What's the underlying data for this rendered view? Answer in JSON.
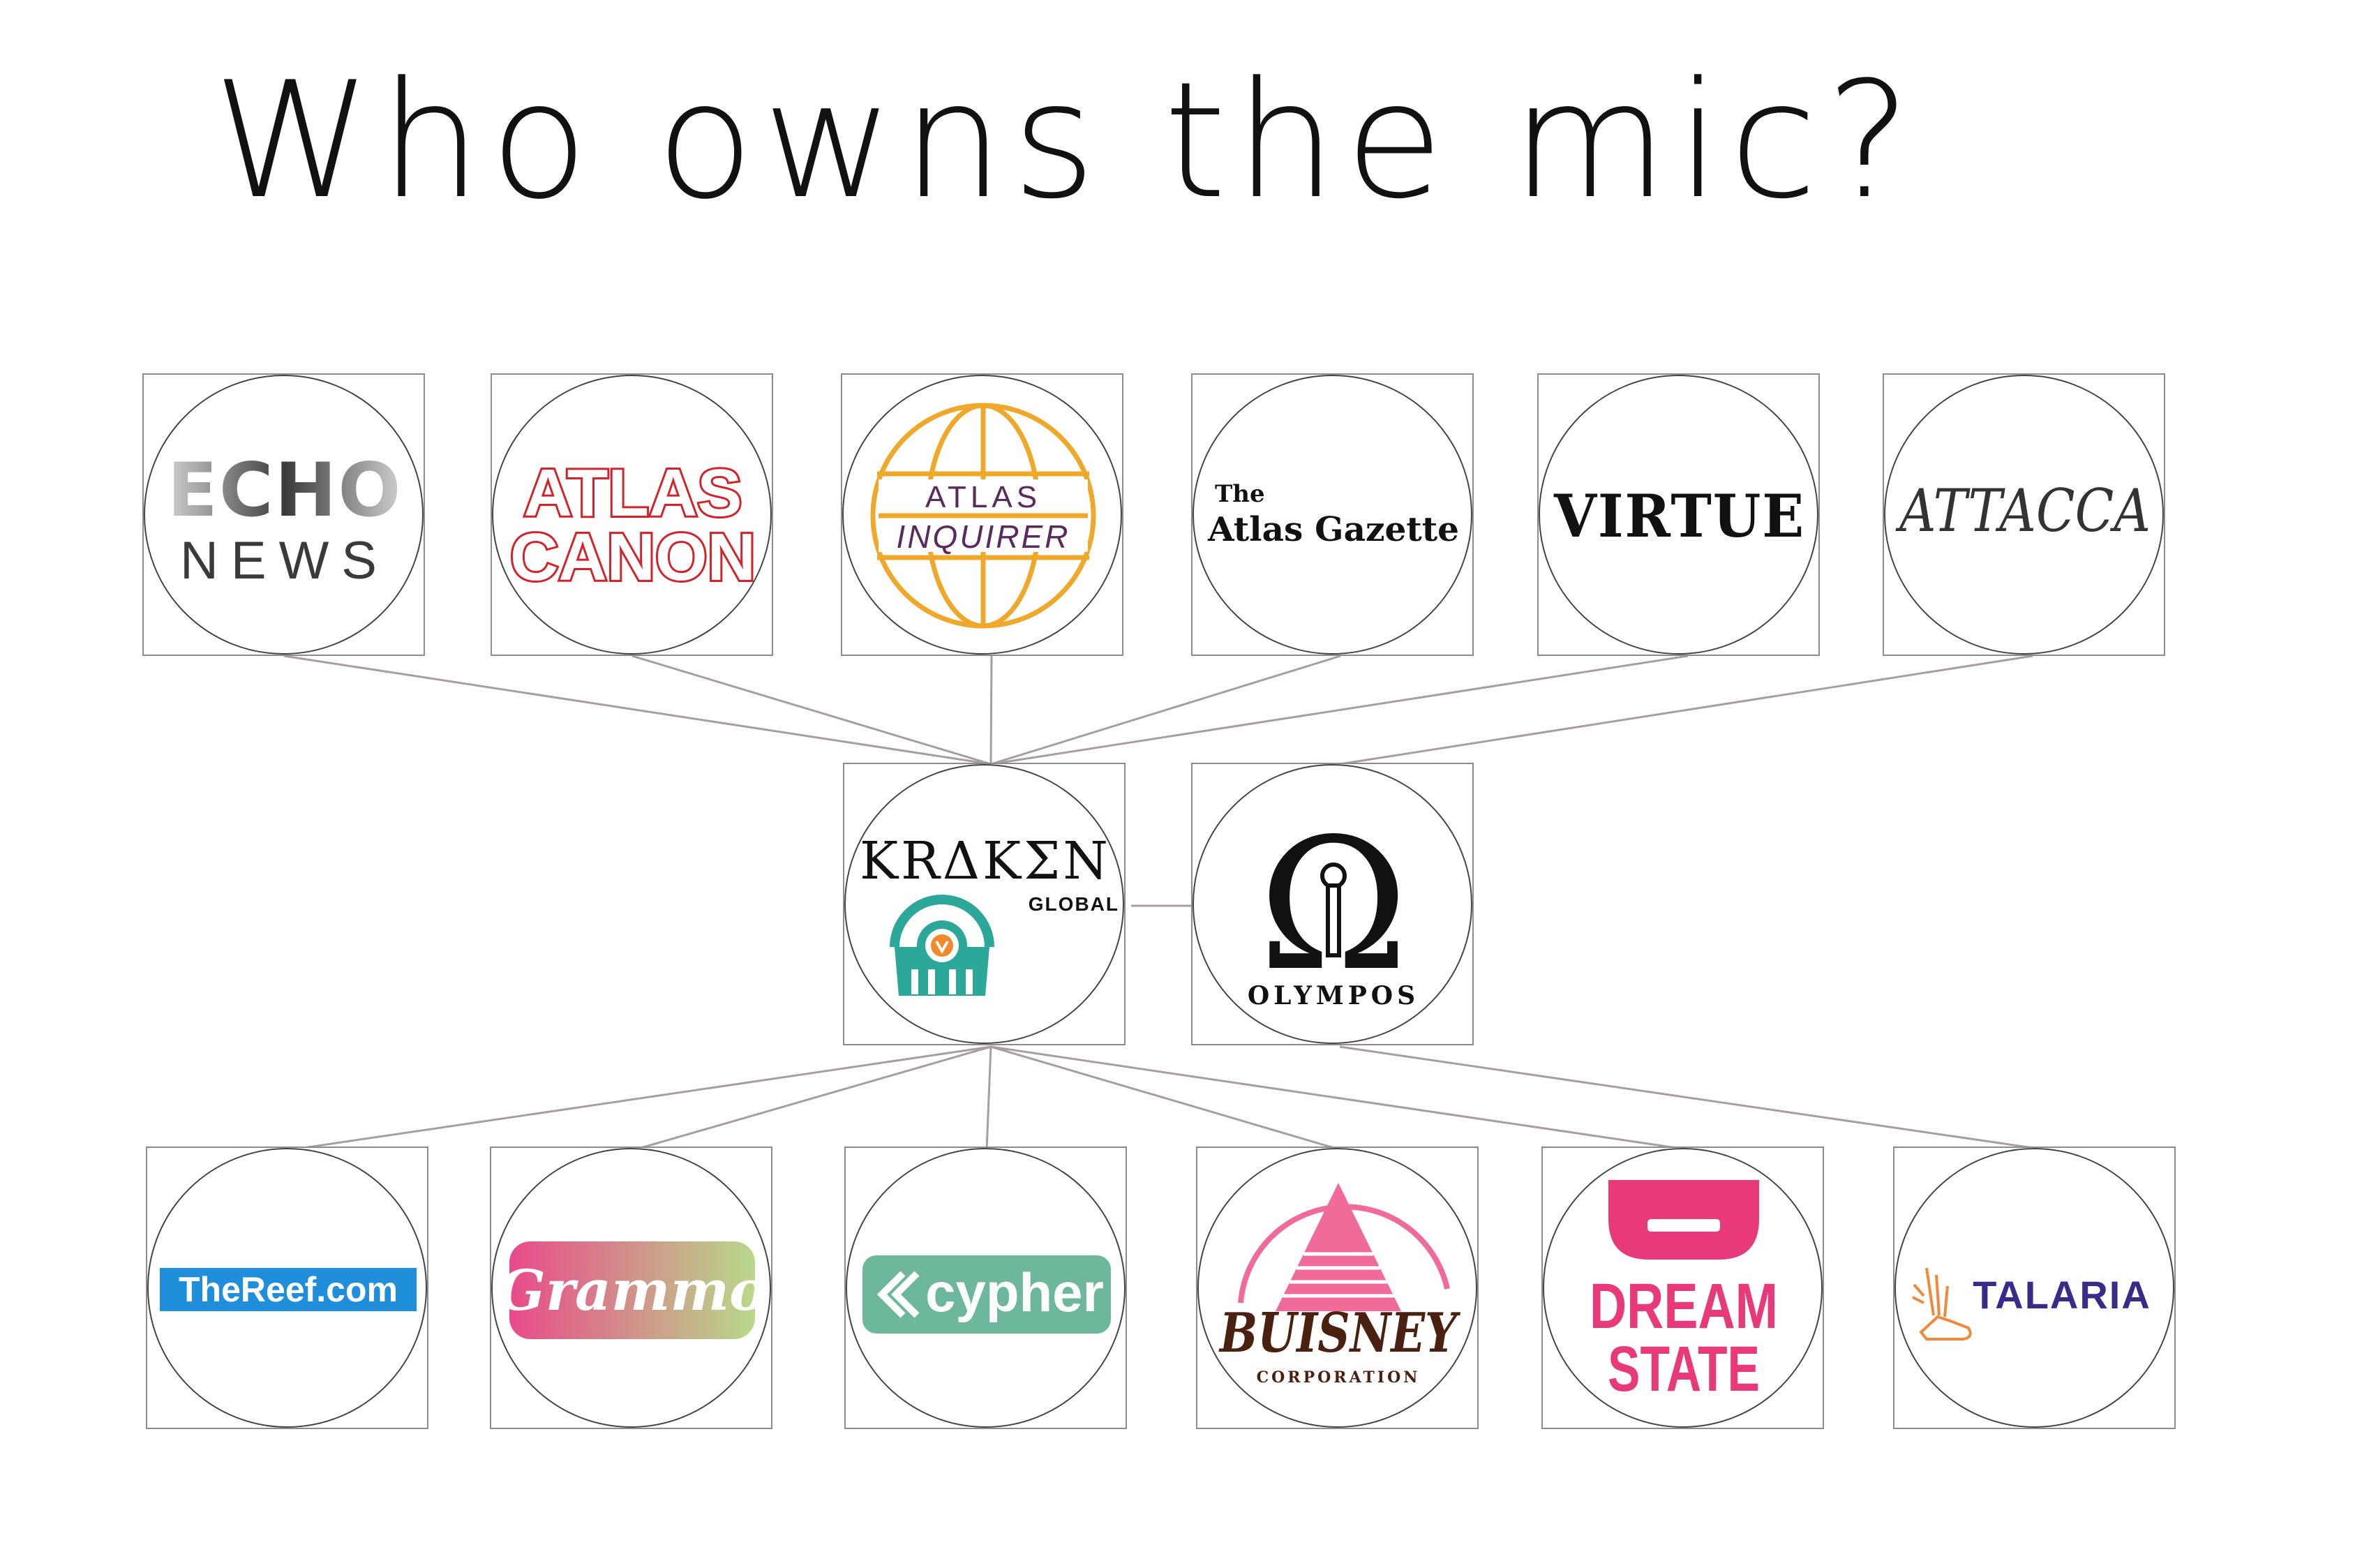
{
  "title": "Who owns the mic?",
  "nodes": {
    "echo": {
      "line1": "ECHO",
      "line2": "NEWS"
    },
    "canon": {
      "line1": "ATLAS",
      "line2": "CANON"
    },
    "inquirer": {
      "line1": "ATLAS",
      "line2": "INQUIRER"
    },
    "gazette": {
      "line1": "The",
      "line2": "Atlas Gazette"
    },
    "virtue": {
      "line1": "VIRTUE"
    },
    "attacca": {
      "line1": "ATTACCA"
    },
    "kraken": {
      "line1": "KRΔKΣN",
      "line2": "GLOBAL"
    },
    "olympos": {
      "glyph": "Ω",
      "line1": "OLYMPOS"
    },
    "reef": {
      "line1": "TheReef.com"
    },
    "grammo": {
      "line1": "Grammo"
    },
    "cypher": {
      "line1": "cypher"
    },
    "buisney": {
      "line1": "BUISNEY",
      "line2": "CORPORATION"
    },
    "dream": {
      "line1": "DREAM",
      "line2": "STATE"
    },
    "talaria": {
      "line1": "TALARIA"
    }
  },
  "colors": {
    "connector": "#a89ea2",
    "canon_red": "#d3222a",
    "inquirer_gold": "#f0a82a",
    "inquirer_purple": "#5a2a5e",
    "kraken_teal": "#2ba89a",
    "kraken_orange": "#f08a2a",
    "reef_blue": "#1f8fdc",
    "grammo_pink": "#e94a8a",
    "grammo_green": "#b8d98a",
    "cypher_green": "#6db89a",
    "buisney_pink": "#f06a9a",
    "buisney_brown": "#4a2010",
    "dream_pink": "#e83a7a",
    "talaria_purple": "#3a2a8a",
    "talaria_orange": "#f08a3a"
  }
}
